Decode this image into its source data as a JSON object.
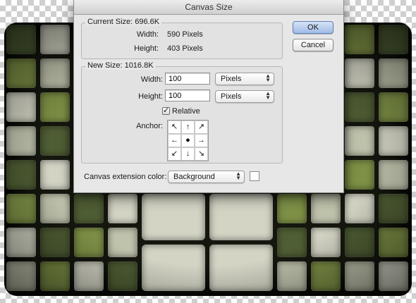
{
  "dialog": {
    "title": "Canvas Size",
    "current_size": {
      "legend": "Current Size: 696.6K",
      "width_label": "Width:",
      "width_value": "590 Pixels",
      "height_label": "Height:",
      "height_value": "403 Pixels"
    },
    "new_size": {
      "legend": "New Size: 1016.8K",
      "width_label": "Width:",
      "width_value": "100",
      "width_unit": "Pixels",
      "height_label": "Height:",
      "height_value": "100",
      "height_unit": "Pixels",
      "relative_label": "Relative",
      "relative_checked": true,
      "anchor_label": "Anchor:",
      "anchor_glyphs": [
        "↖",
        "↑",
        "↗",
        "←",
        "●",
        "→",
        "↙",
        "↓",
        "↘"
      ]
    },
    "extension": {
      "label": "Canvas extension color:",
      "value": "Background",
      "swatch_color": "#ffffff"
    },
    "buttons": {
      "ok": "OK",
      "cancel": "Cancel"
    }
  },
  "colors": {
    "tile_green": "#7e9146",
    "tile_dark_green": "#4f5e34",
    "tile_pale": "#bfc3ac",
    "tile_light": "#d3d4c4",
    "default_button": "#9fbbe6"
  }
}
